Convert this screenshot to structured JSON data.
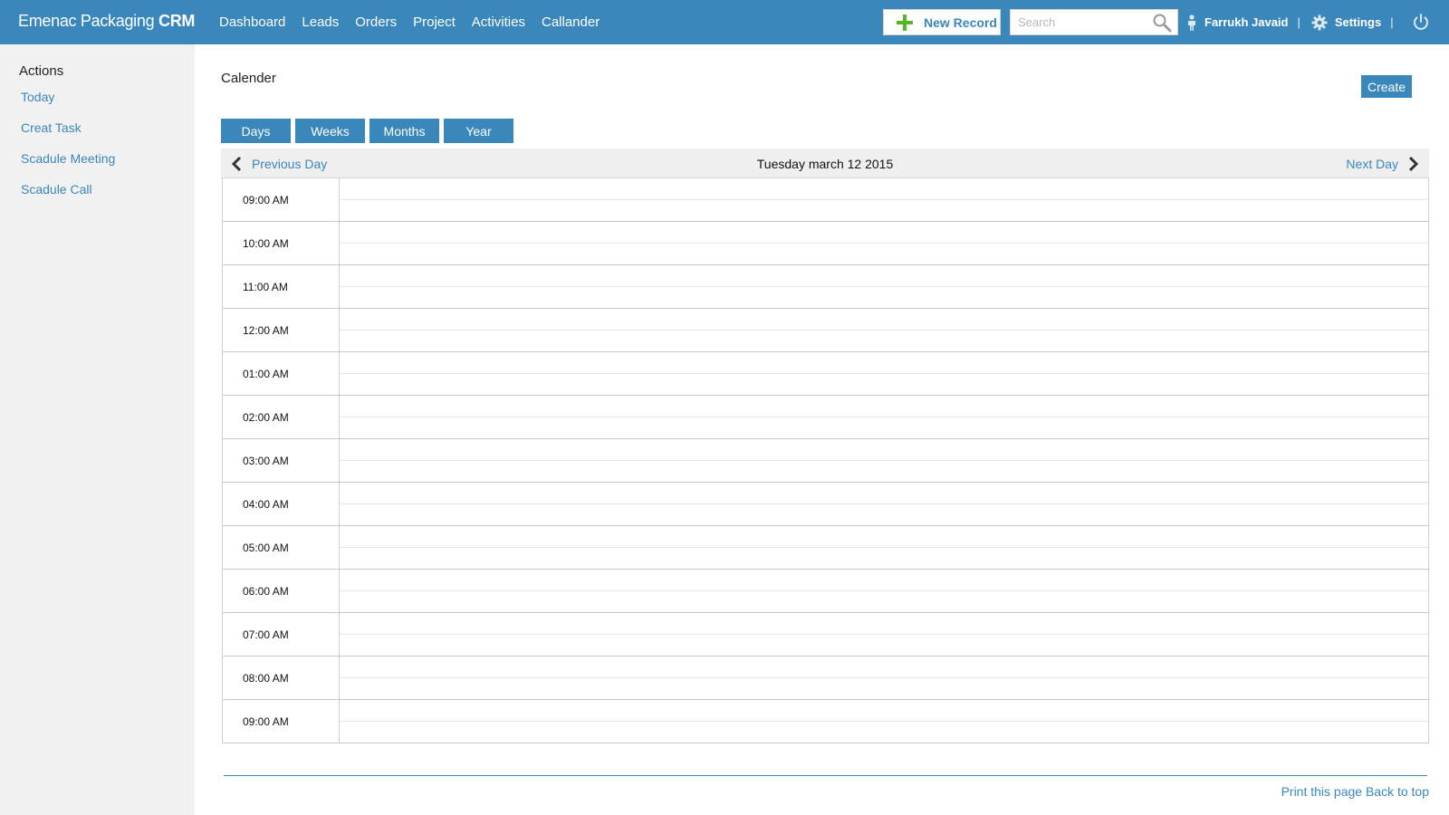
{
  "header": {
    "brand_light": "Emenac Packaging",
    "brand_strong": "CRM",
    "nav": [
      "Dashboard",
      "Leads",
      "Orders",
      "Project",
      "Activities",
      "Callander"
    ],
    "new_record_label": "New Record",
    "search_placeholder": "Search",
    "user_name": "Farrukh Javaid",
    "settings_label": "Settings",
    "separator": "|"
  },
  "sidebar": {
    "title": "Actions",
    "items": [
      "Today",
      "Creat Task",
      "Scadule Meeting",
      "Scadule Call"
    ]
  },
  "main": {
    "title": "Calender",
    "create_label": "Create",
    "view_tabs": [
      "Days",
      "Weeks",
      "Months",
      "Year"
    ],
    "prev_label": "Previous Day",
    "next_label": "Next Day",
    "current_date": "Tuesday march 12 2015",
    "time_slots": [
      "09:00 AM",
      "10:00 AM",
      "11:00 AM",
      "12:00 AM",
      "01:00 AM",
      "02:00 AM",
      "03:00 AM",
      "04:00 AM",
      "05:00 AM",
      "06:00 AM",
      "07:00 AM",
      "08:00 AM",
      "09:00 AM"
    ]
  },
  "footer": {
    "print_label": "Print this page",
    "top_label": "Back to top"
  },
  "colors": {
    "accent": "#3a87bb",
    "plus_icon": "#55b42a",
    "sidebar_bg": "#f1f1f1"
  },
  "icons": [
    "plus-icon",
    "search-icon",
    "user-icon",
    "gear-icon",
    "power-icon",
    "chevron-left-icon",
    "chevron-right-icon"
  ]
}
